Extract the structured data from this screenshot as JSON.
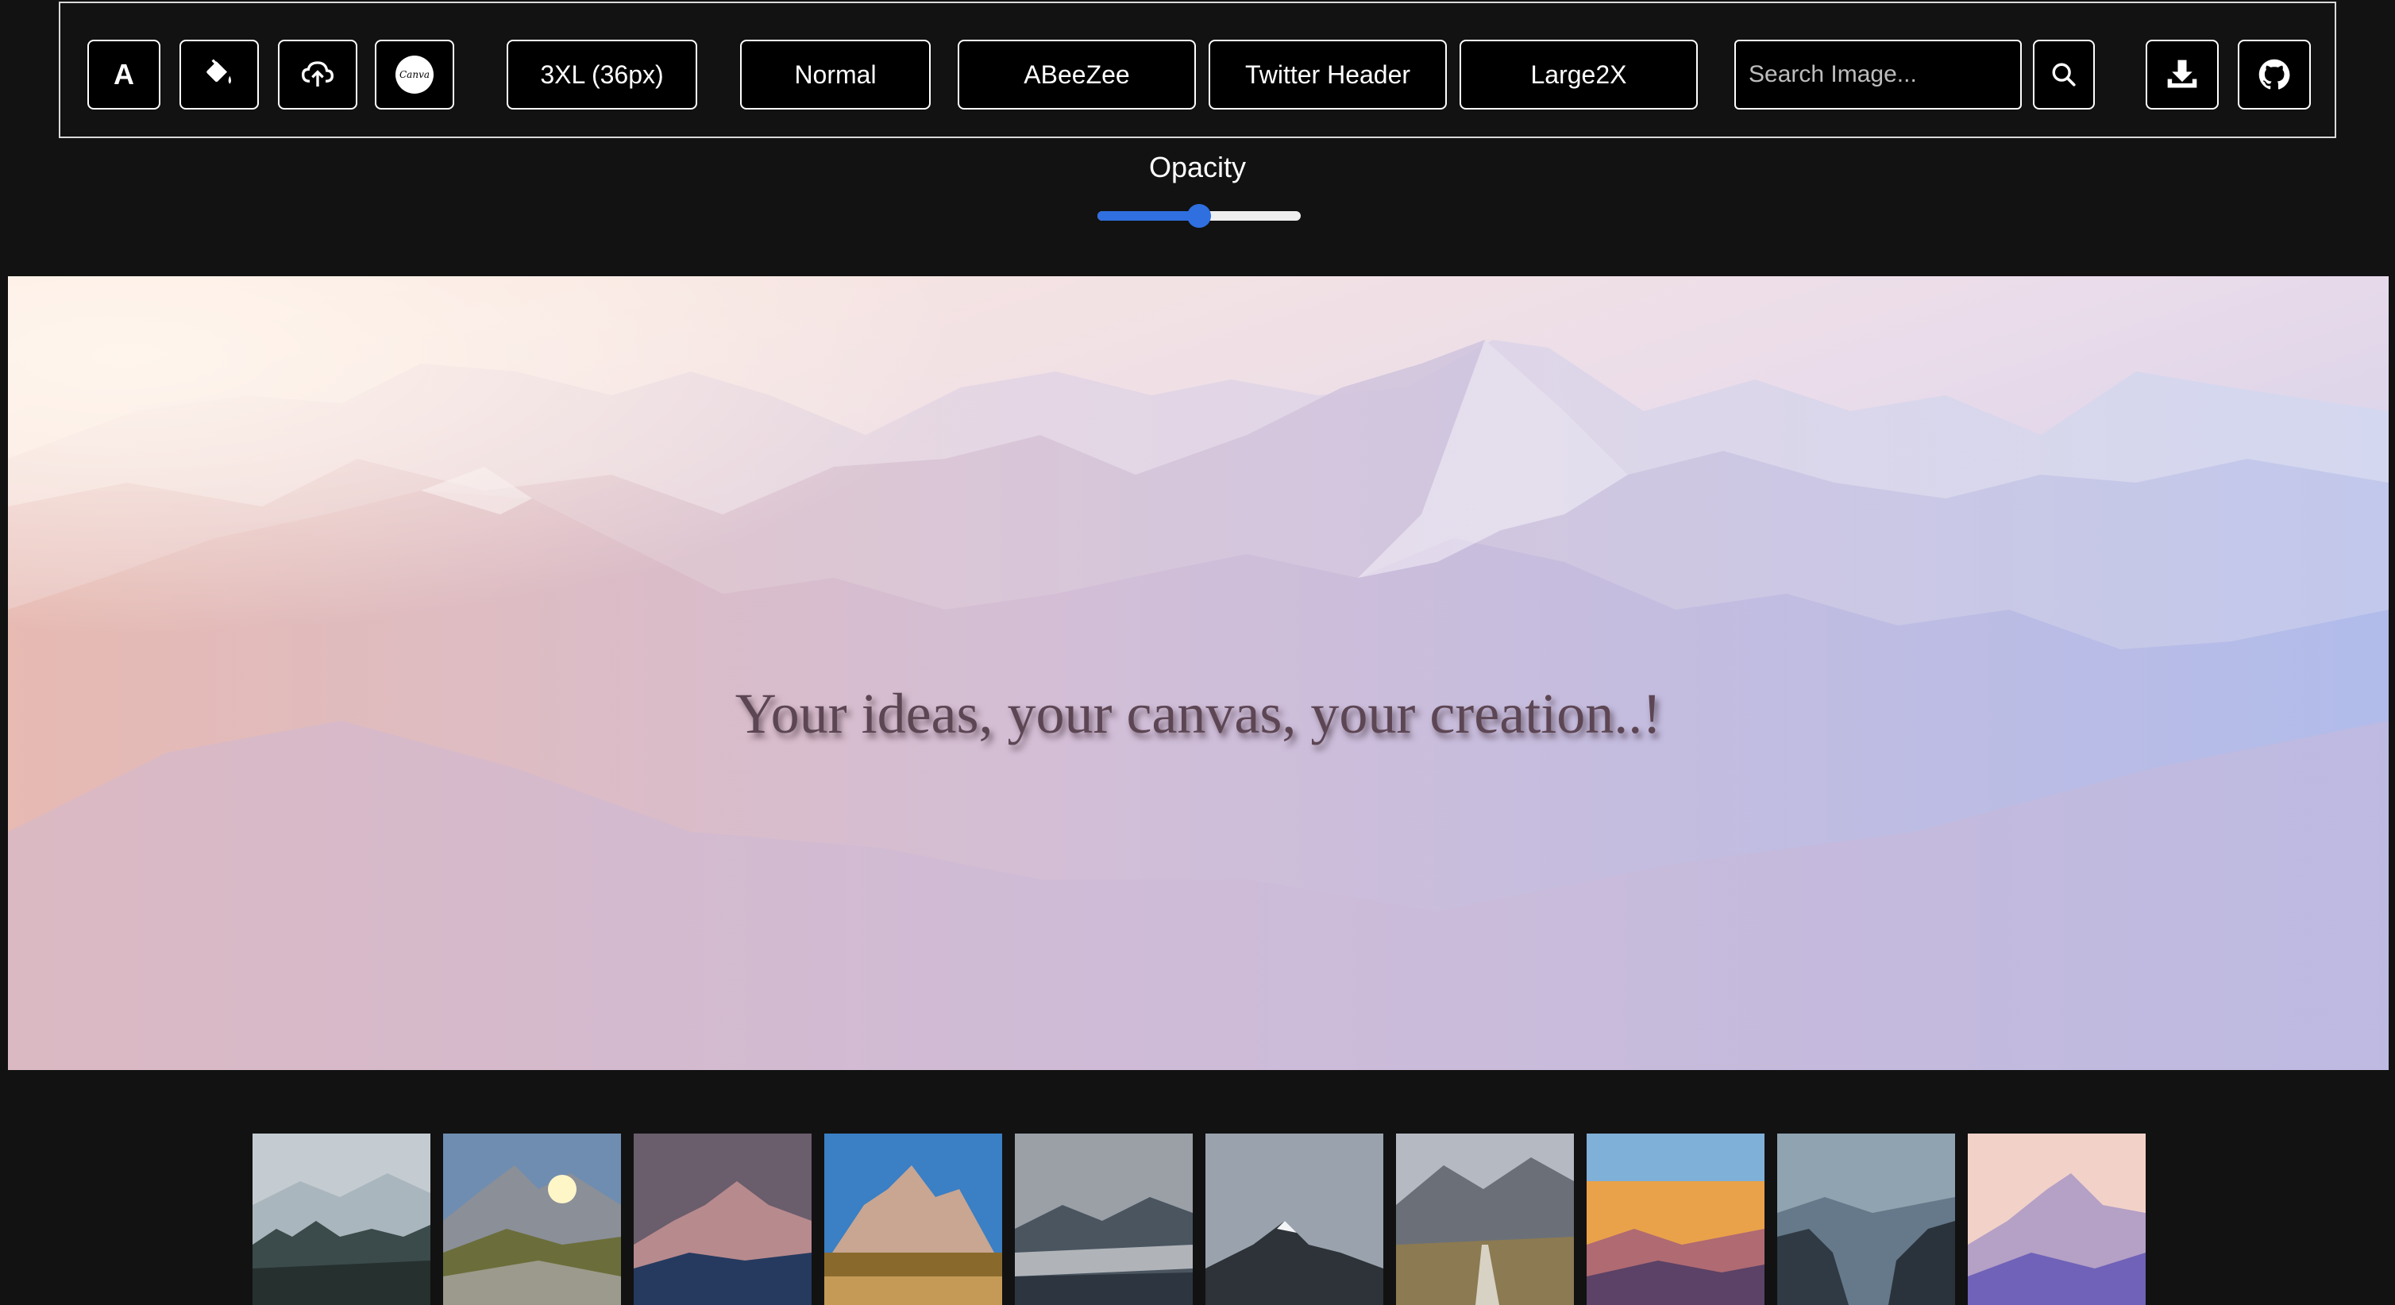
{
  "toolbar": {
    "text_button_label": "A",
    "fill_icon": "paint-bucket-icon",
    "upload_icon": "cloud-upload-icon",
    "canva_label": "Canva",
    "size_label": "3XL (36px)",
    "weight_label": "Normal",
    "font_label": "ABeeZee",
    "preset_label": "Twitter Header",
    "quality_label": "Large2X",
    "search_placeholder": "Search Image...",
    "search_icon": "search-icon",
    "download_icon": "download-icon",
    "github_icon": "github-icon"
  },
  "opacity": {
    "label": "Opacity",
    "value": 0.5
  },
  "canvas": {
    "text": "Your ideas, your canvas, your creation..!",
    "text_color": "#5d4654"
  },
  "thumbnails": [
    {
      "name": "misty-forest-mountains"
    },
    {
      "name": "sunburst-rocky-peak"
    },
    {
      "name": "purple-dusk-ridge"
    },
    {
      "name": "grand-teton-autumn"
    },
    {
      "name": "cloudy-dark-range"
    },
    {
      "name": "overcast-snow-peak"
    },
    {
      "name": "boardwalk-valley-path"
    },
    {
      "name": "sunset-layered-hills"
    },
    {
      "name": "foggy-cliff-valley"
    },
    {
      "name": "pastel-sunrise-peaks"
    }
  ],
  "colors": {
    "background": "#121212",
    "border": "#ffffff",
    "slider_accent": "#2f6fe0"
  }
}
